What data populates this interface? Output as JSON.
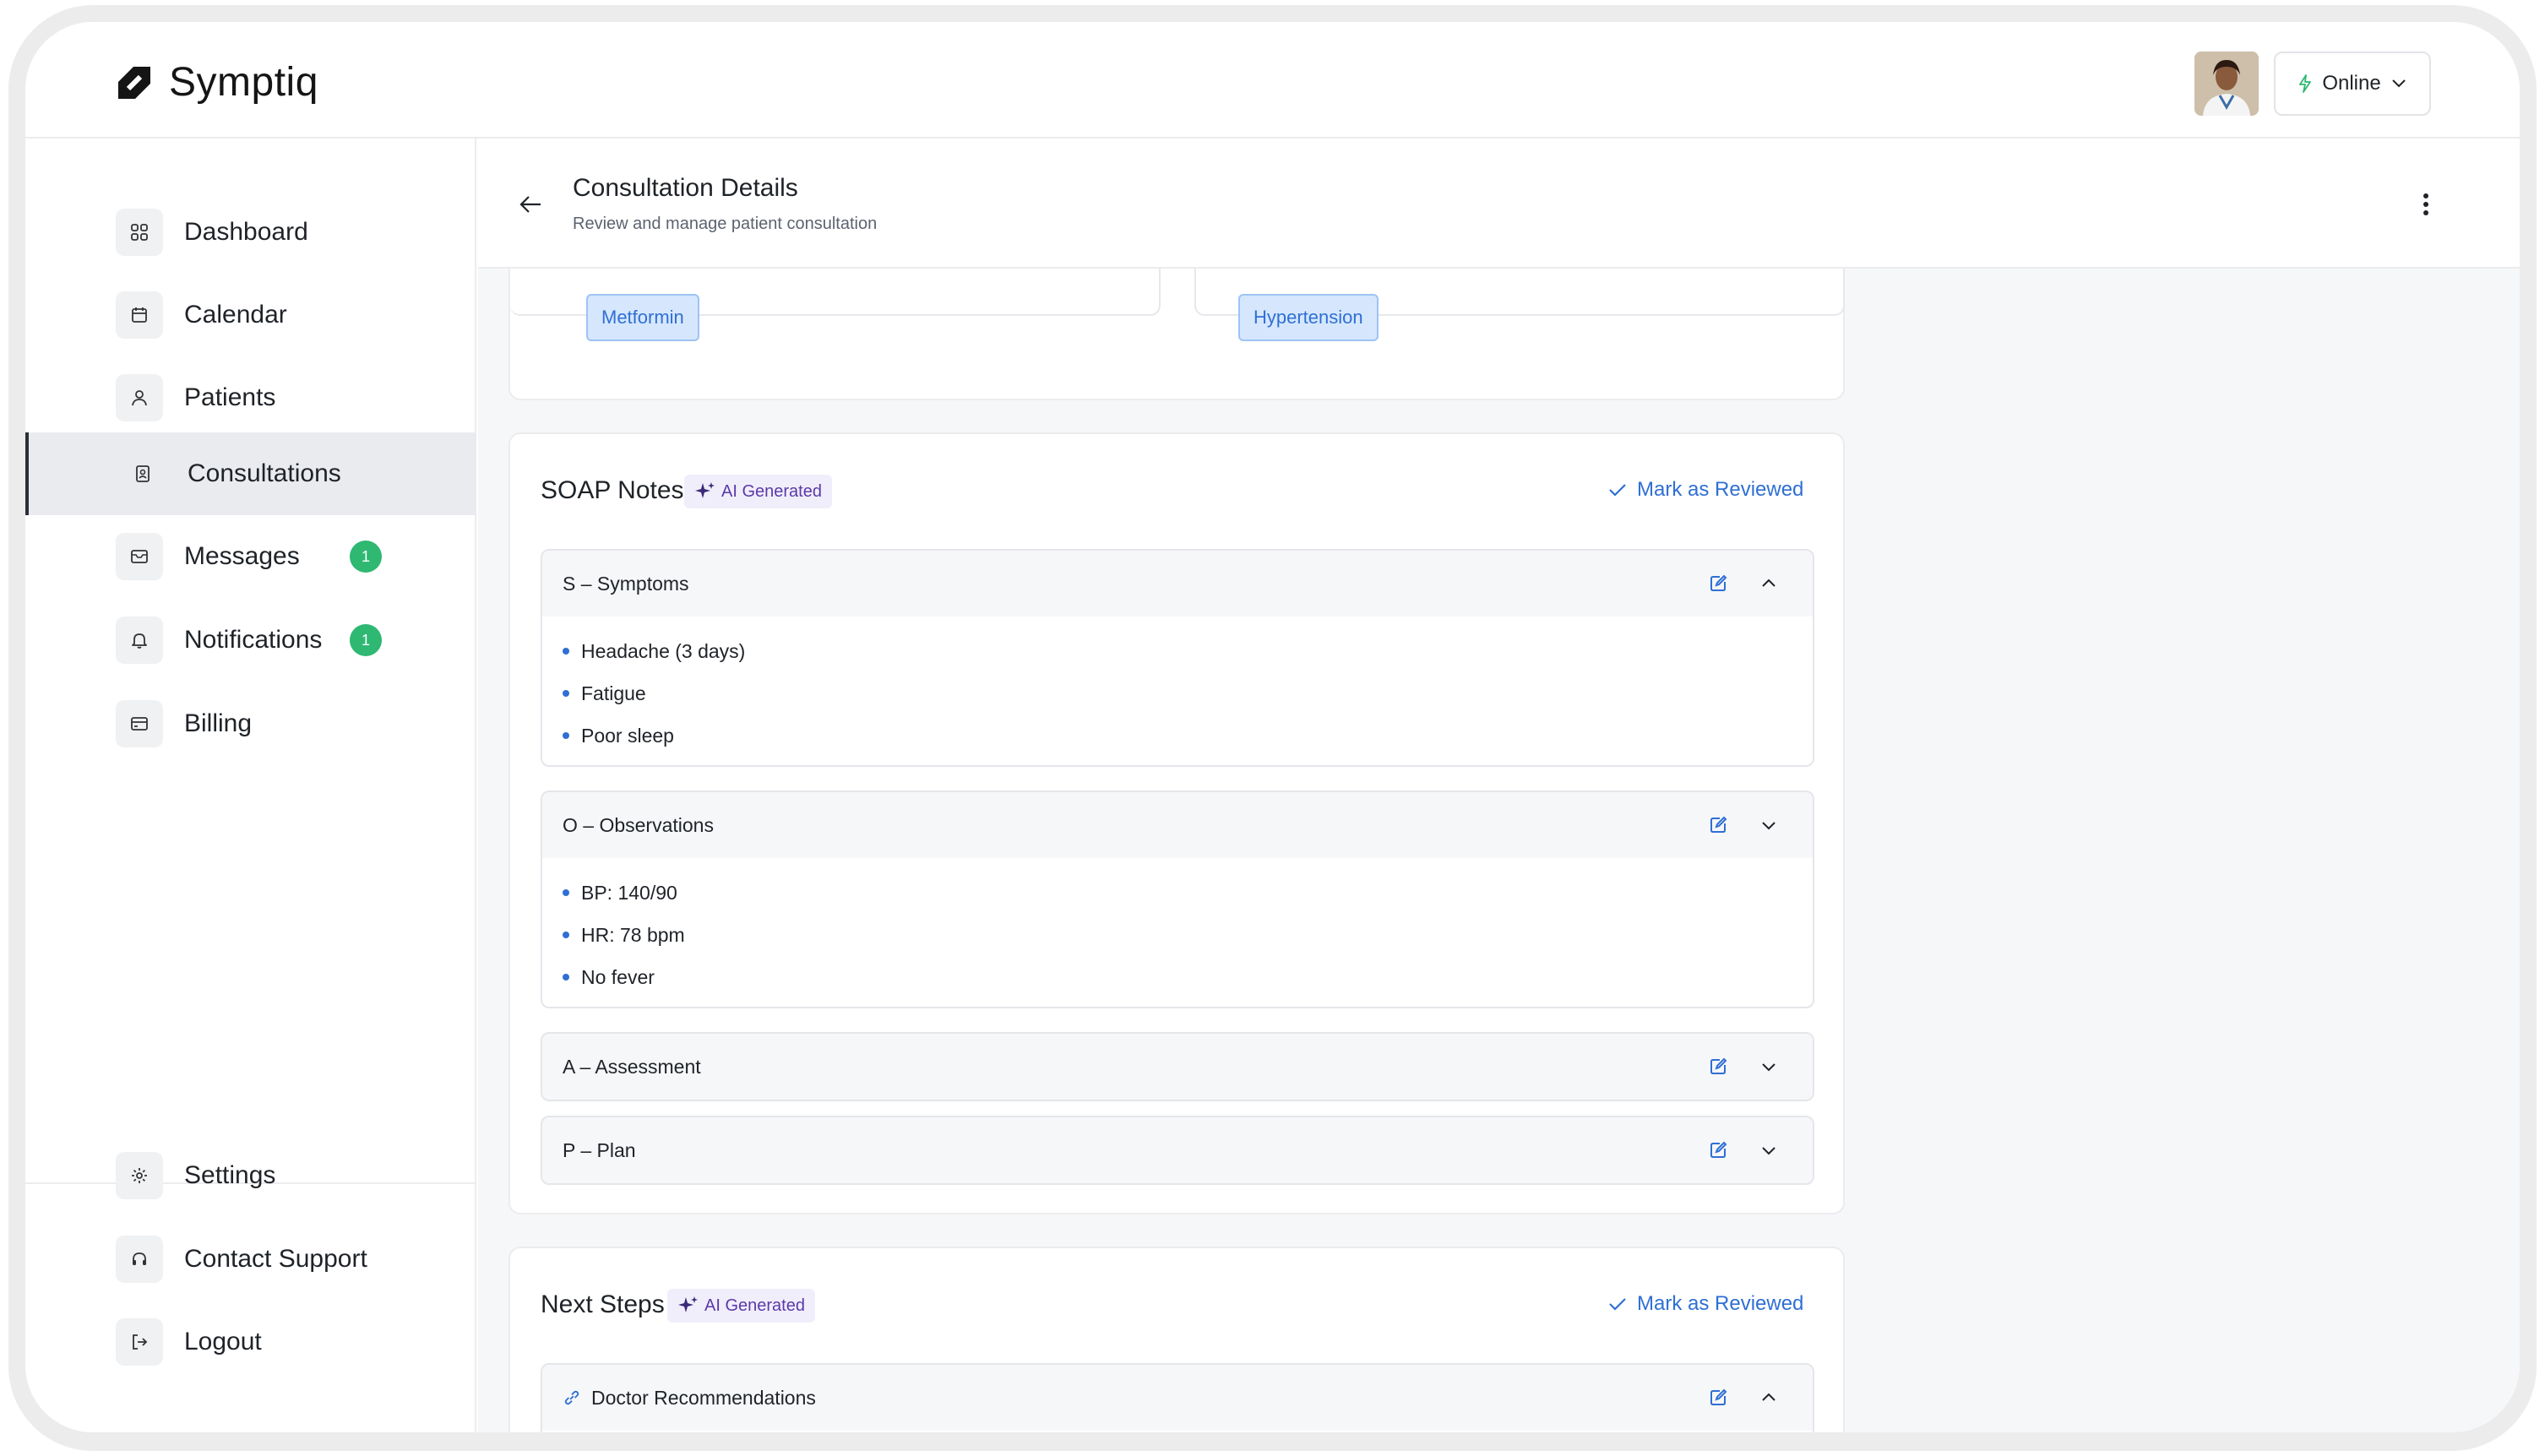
{
  "app": {
    "name": "Symptiq"
  },
  "header": {
    "status_label": "Online"
  },
  "sidebar": {
    "items": [
      {
        "label": "Dashboard",
        "icon": "grid-icon"
      },
      {
        "label": "Calendar",
        "icon": "calendar-icon"
      },
      {
        "label": "Patients",
        "icon": "user-icon"
      },
      {
        "label": "Consultations",
        "icon": "file-user-icon",
        "active": true
      },
      {
        "label": "Messages",
        "icon": "mail-icon",
        "badge": "1"
      },
      {
        "label": "Notifications",
        "icon": "bell-icon",
        "badge": "1"
      },
      {
        "label": "Billing",
        "icon": "card-icon"
      }
    ],
    "bottom_items": [
      {
        "label": "Settings",
        "icon": "gear-icon"
      },
      {
        "label": "Contact Support",
        "icon": "headset-icon"
      },
      {
        "label": "Logout",
        "icon": "logout-icon"
      }
    ]
  },
  "page": {
    "title": "Consultation Details",
    "subtitle": "Review and manage patient consultation"
  },
  "top_card": {
    "medication_chip": "Metformin",
    "condition_chip": "Hypertension"
  },
  "soap": {
    "title": "SOAP Notes",
    "ai_tag": "AI Generated",
    "mark_reviewed": "Mark as Reviewed",
    "sections": [
      {
        "title": "S – Symptoms",
        "items": [
          "Headache (3 days)",
          "Fatigue",
          "Poor sleep"
        ],
        "expanded": true
      },
      {
        "title": "O – Observations",
        "items": [
          "BP: 140/90",
          "HR: 78 bpm",
          "No fever"
        ],
        "expanded": true
      },
      {
        "title": "A – Assessment",
        "items": [],
        "expanded": false
      },
      {
        "title": "P – Plan",
        "items": [],
        "expanded": false
      }
    ]
  },
  "next_steps": {
    "title": "Next Steps",
    "ai_tag": "AI Generated",
    "mark_reviewed": "Mark as Reviewed",
    "first_section": "Doctor Recommendations"
  },
  "colors": {
    "accent_blue": "#2f6fd4",
    "badge_green": "#2eb872",
    "ai_purple": "#5a3aa8"
  }
}
